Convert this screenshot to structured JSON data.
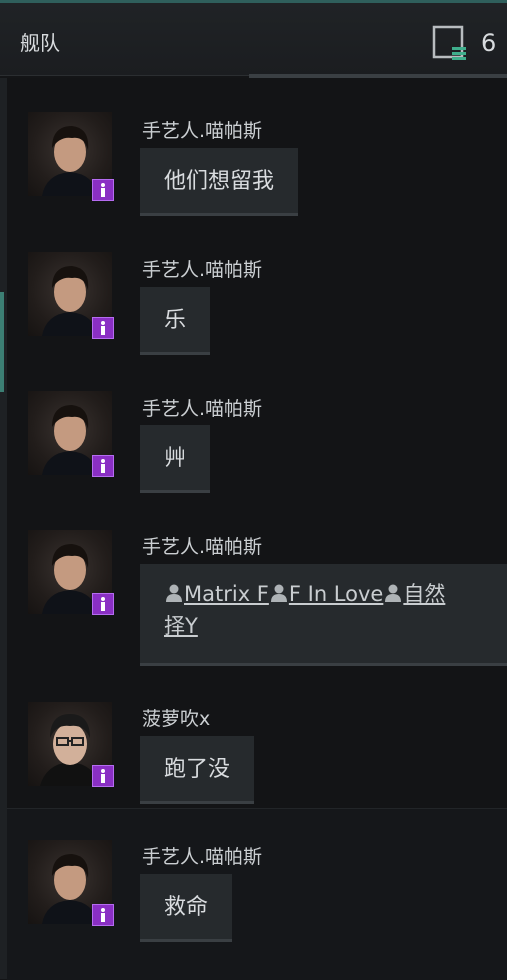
{
  "header": {
    "title": "舰队",
    "member_count": "6"
  },
  "messages": [
    {
      "sender": "手艺人.喵帕斯",
      "text": "他们想留我"
    },
    {
      "sender": "手艺人.喵帕斯",
      "text": "乐"
    },
    {
      "sender": "手艺人.喵帕斯",
      "text": "艸"
    },
    {
      "sender": "手艺人.喵帕斯",
      "links": [
        "Matrix F",
        "F In Love",
        "自然"
      ],
      "link_tail": "择Y"
    },
    {
      "sender": "菠萝吹ⅹ",
      "text": "跑了没"
    },
    {
      "sender": "手艺人.喵帕斯",
      "text": "救命"
    }
  ],
  "colors": {
    "accent_teal": "#3c7f74",
    "badge_purple": "#8a2fc4",
    "bubble": "#262a2d"
  },
  "icons": {
    "members": "member-list-icon",
    "badge": "role-badge-icon",
    "link": "person-icon"
  }
}
